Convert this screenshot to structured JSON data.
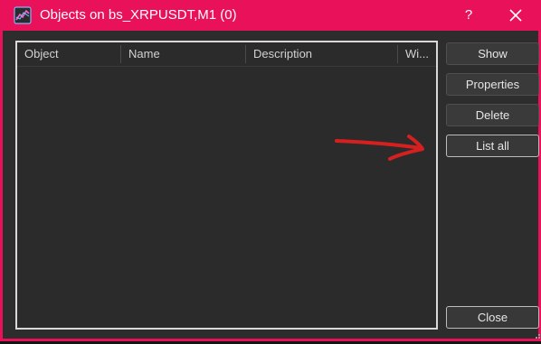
{
  "window": {
    "title": "Objects on bs_XRPUSDT,M1 (0)",
    "help_label": "?",
    "accent_color": "#e8115a"
  },
  "icons": {
    "app": "chart-window-icon",
    "close": "close-icon",
    "annotation": "red-arrow-annotation",
    "grip": "resize-grip-icon"
  },
  "table": {
    "columns": [
      "Object",
      "Name",
      "Description",
      "Wi..."
    ],
    "rows": []
  },
  "buttons": {
    "show": "Show",
    "properties": "Properties",
    "delete": "Delete",
    "list_all": "List all",
    "close": "Close"
  }
}
